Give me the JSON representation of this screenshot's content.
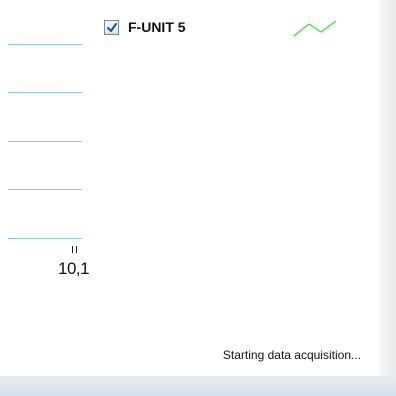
{
  "legend": {
    "series_label": "F-UNIT 5",
    "checked": true,
    "swatch_color": "#3fdc3f",
    "checkbox_icon": "checkmark-icon"
  },
  "axis": {
    "x_tick_label": "10,1",
    "grid_color": "#8fc9cf"
  },
  "status": {
    "text": "Starting data acquisition..."
  }
}
